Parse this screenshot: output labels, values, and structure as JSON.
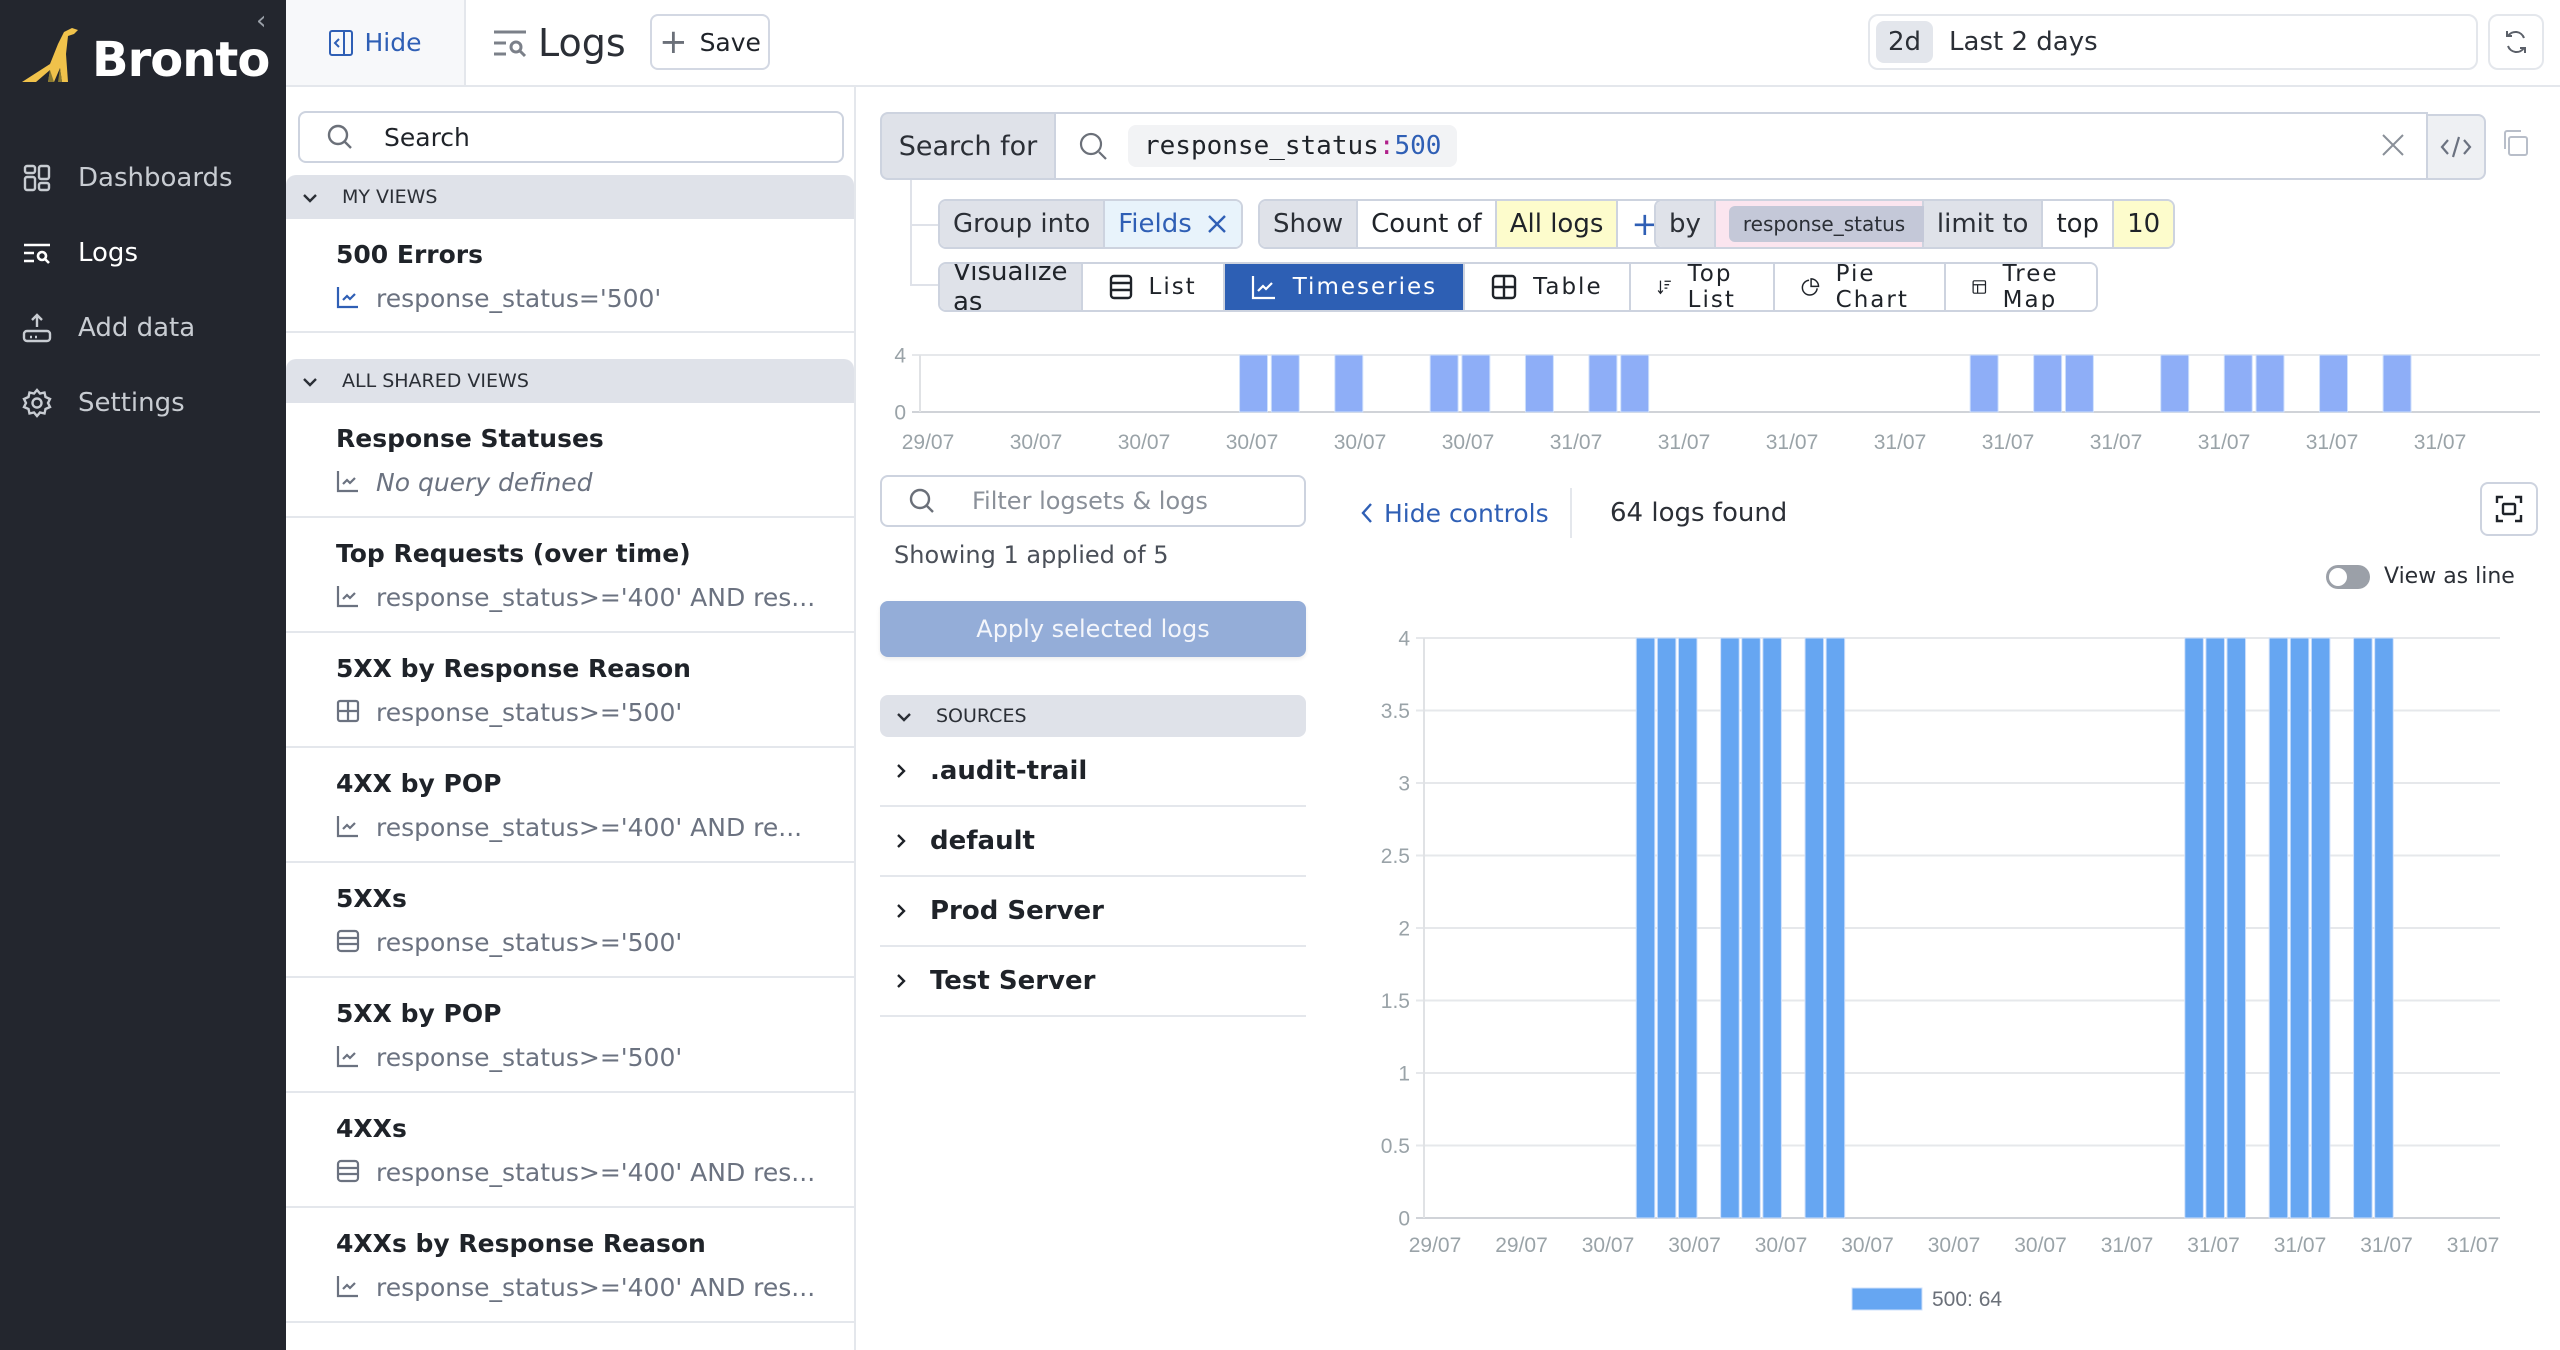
{
  "app": {
    "brand": "Bronto",
    "collapse_glyph": "‹",
    "nav": [
      {
        "label": "Dashboards",
        "icon": "dashboard-icon",
        "active": false
      },
      {
        "label": "Logs",
        "icon": "logs-icon",
        "active": true
      },
      {
        "label": "Add data",
        "icon": "upload-icon",
        "active": false
      },
      {
        "label": "Settings",
        "icon": "gear-icon",
        "active": false
      }
    ]
  },
  "topbar": {
    "hide_label": "Hide",
    "title": "Logs",
    "save_label": "Save",
    "time_badge": "2d",
    "time_range": "Last 2 days"
  },
  "views": {
    "search_placeholder": "Search",
    "my_views_header": "MY VIEWS",
    "my_views": [
      {
        "name": "500 Errors",
        "query": "response_status='500'",
        "icon": "timeseries-icon",
        "italic": false,
        "accent": true
      }
    ],
    "shared_header": "ALL SHARED VIEWS",
    "shared_views": [
      {
        "name": "Response Statuses",
        "query": "No query defined",
        "icon": "timeseries-icon",
        "italic": true
      },
      {
        "name": "Top Requests (over time)",
        "query": "response_status>='400' AND res...",
        "icon": "timeseries-icon",
        "italic": false
      },
      {
        "name": "5XX by Response Reason",
        "query": "response_status>='500'",
        "icon": "table-icon",
        "italic": false
      },
      {
        "name": "4XX by POP",
        "query": "response_status>='400' AND re...",
        "icon": "timeseries-icon",
        "italic": false
      },
      {
        "name": "5XXs",
        "query": "response_status>='500'",
        "icon": "list-icon",
        "italic": false
      },
      {
        "name": "5XX by POP",
        "query": "response_status>='500'",
        "icon": "timeseries-icon",
        "italic": false
      },
      {
        "name": "4XXs",
        "query": "response_status>='400' AND res...",
        "icon": "list-icon",
        "italic": false
      },
      {
        "name": "4XXs by Response Reason",
        "query": "response_status>='400' AND res...",
        "icon": "timeseries-icon",
        "italic": false
      }
    ]
  },
  "query": {
    "search_label": "Search for",
    "field": "response_status",
    "operator": ":",
    "value": "500",
    "group_label": "Group into",
    "group_value": "Fields",
    "show_label": "Show",
    "count_of": "Count of",
    "count_target": "All logs",
    "add_glyph": "+",
    "by_label": "by",
    "by_field": "response_status",
    "limit_label": "limit to",
    "limit_mode": "top",
    "limit_value": "10",
    "visualize_label": "Visualize as",
    "viz_options": [
      {
        "label": "List",
        "icon": "list-icon",
        "active": false
      },
      {
        "label": "Timeseries",
        "icon": "timeseries-icon",
        "active": true
      },
      {
        "label": "Table",
        "icon": "table-icon",
        "active": false
      },
      {
        "label": "Top List",
        "icon": "sort-desc-icon",
        "active": false
      },
      {
        "label": "Pie Chart",
        "icon": "pie-chart-icon",
        "active": false
      },
      {
        "label": "Tree Map",
        "icon": "tree-map-icon",
        "active": false
      }
    ]
  },
  "sources": {
    "filter_placeholder": "Filter logsets & logs",
    "showing_text": "Showing 1 applied of 5",
    "apply_label": "Apply selected logs",
    "header": "SOURCES",
    "items": [
      ".audit-trail",
      "default",
      "Prod Server",
      "Test Server"
    ]
  },
  "results": {
    "hide_controls_label": "Hide controls",
    "logs_found": "64 logs found",
    "view_as_line_label": "View as line",
    "view_as_line_on": false
  },
  "colors": {
    "accent": "#2d5fb4",
    "bar_main": "#66a6f2",
    "bar_mini": "#8eaef7",
    "sidebar_bg": "#23262e"
  },
  "chart_data": [
    {
      "name": "overview",
      "type": "bar",
      "ylim": [
        0,
        4
      ],
      "yticks": [
        "0",
        "4"
      ],
      "xticks": [
        "29/07",
        "30/07",
        "30/07",
        "30/07",
        "30/07",
        "30/07",
        "31/07",
        "31/07",
        "31/07",
        "31/07",
        "31/07",
        "31/07",
        "31/07",
        "31/07",
        "31/07"
      ],
      "bucket_count": 51,
      "series": [
        {
          "name": "500",
          "buckets": [
            10,
            11,
            13,
            16,
            17,
            19,
            21,
            22,
            33,
            35,
            36,
            39,
            41,
            42,
            44,
            46
          ],
          "value": 4
        }
      ],
      "grid": true
    },
    {
      "name": "main",
      "type": "bar",
      "ylim": [
        0,
        4
      ],
      "yticks": [
        "0",
        "0.5",
        "1",
        "1.5",
        "2",
        "2.5",
        "3",
        "3.5",
        "4"
      ],
      "xticks": [
        "29/07",
        "29/07",
        "30/07",
        "30/07",
        "30/07",
        "30/07",
        "30/07",
        "30/07",
        "31/07",
        "31/07",
        "31/07",
        "31/07",
        "31/07"
      ],
      "bucket_count": 51,
      "series": [
        {
          "name": "500",
          "buckets": [
            10,
            11,
            12,
            14,
            15,
            16,
            18,
            19,
            36,
            37,
            38,
            40,
            41,
            42,
            44,
            45
          ],
          "value": 4
        }
      ],
      "legend": [
        "500: 64"
      ],
      "legend_position": "bottom-center",
      "grid": true
    }
  ]
}
